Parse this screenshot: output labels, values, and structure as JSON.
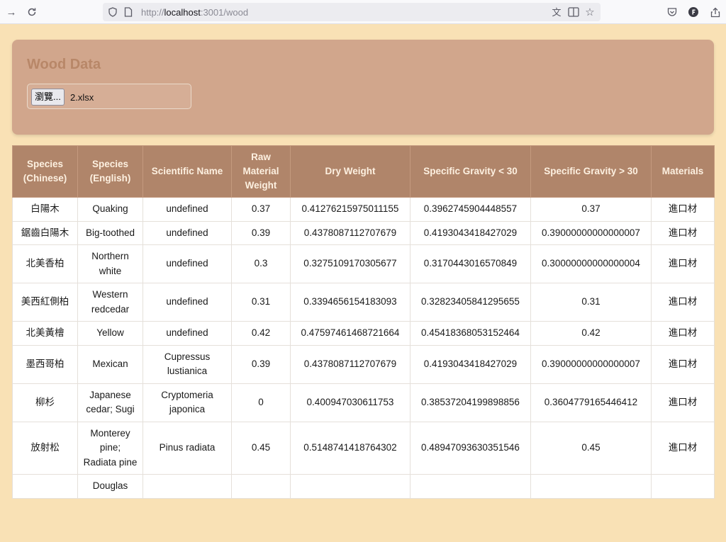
{
  "browser": {
    "url_prefix": "http://",
    "url_host": "localhost",
    "url_rest": ":3001/wood",
    "icons": [
      "forward-arrow-icon",
      "reload-icon",
      "shield-icon",
      "page-icon",
      "translate-icon",
      "reader-icon",
      "star-icon",
      "pocket-icon",
      "account-icon",
      "share-icon"
    ]
  },
  "page": {
    "title": "Wood Data",
    "browse_label": "瀏覽...",
    "file_name": "2.xlsx"
  },
  "table": {
    "headers": [
      "Species (Chinese)",
      "Species (English)",
      "Scientific Name",
      "Raw Material Weight",
      "Dry Weight",
      "Specific Gravity < 30",
      "Specific Gravity > 30",
      "Materials"
    ],
    "rows": [
      [
        "白陽木",
        "Quaking",
        "undefined",
        "0.37",
        "0.41276215975011155",
        "0.3962745904448557",
        "0.37",
        "進口材"
      ],
      [
        "鋸齒白陽木",
        "Big-toothed",
        "undefined",
        "0.39",
        "0.4378087112707679",
        "0.4193043418427029",
        "0.39000000000000007",
        "進口材"
      ],
      [
        "北美香柏",
        "Northern white",
        "undefined",
        "0.3",
        "0.3275109170305677",
        "0.3170443016570849",
        "0.30000000000000004",
        "進口材"
      ],
      [
        "美西紅側柏",
        "Western redcedar",
        "undefined",
        "0.31",
        "0.3394656154183093",
        "0.32823405841295655",
        "0.31",
        "進口材"
      ],
      [
        "北美黃檜",
        "Yellow",
        "undefined",
        "0.42",
        "0.47597461468721664",
        "0.45418368053152464",
        "0.42",
        "進口材"
      ],
      [
        "墨西哥柏",
        "Mexican",
        "Cupressus lustianica",
        "0.39",
        "0.4378087112707679",
        "0.4193043418427029",
        "0.39000000000000007",
        "進口材"
      ],
      [
        "柳杉",
        "Japanese cedar; Sugi",
        "Cryptomeria japonica",
        "0",
        "0.400947030611753",
        "0.38537204199898856",
        "0.3604779165446412",
        "進口材"
      ],
      [
        "放射松",
        "Monterey pine; Radiata pine",
        "Pinus radiata",
        "0.45",
        "0.5148741418764302",
        "0.48947093630351546",
        "0.45",
        "進口材"
      ],
      [
        "",
        "Douglas",
        "",
        "",
        "",
        "",
        "",
        ""
      ]
    ]
  }
}
